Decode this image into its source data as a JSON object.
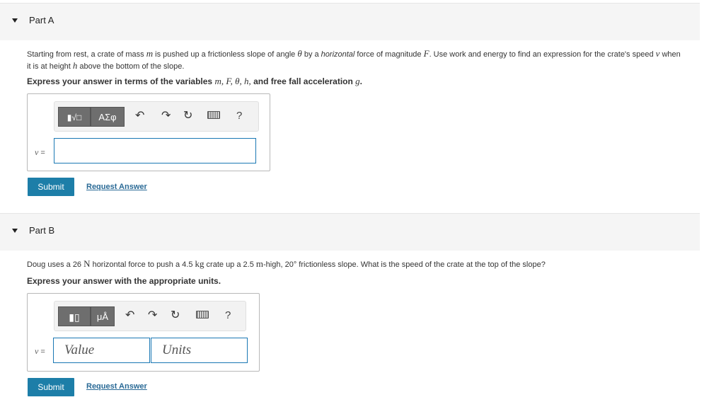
{
  "partA": {
    "title": "Part A",
    "problem": {
      "t1": "Starting from rest, a crate of mass ",
      "m": "m",
      "t2": " is pushed up a frictionless slope of angle ",
      "theta": "θ",
      "t3": " by a ",
      "horizontal": "horizontal",
      "t4": " force of magnitude ",
      "F": "F",
      "t5": ". Use work and energy to find an expression for the crate's speed ",
      "v": "v",
      "t6": " when it is at height ",
      "h": "h",
      "t7": " above the bottom of the slope."
    },
    "instruction": {
      "t1": "Express your answer in terms of the variables ",
      "vars": "m, F, θ, h,",
      "t2": " and free fall acceleration ",
      "g": "g",
      "t3": "."
    },
    "toolbar": {
      "template_label": "▮√□",
      "greek_label": "ΑΣφ",
      "help_label": "?"
    },
    "var_label": "v",
    "eq": " =",
    "submit_label": "Submit",
    "request_label": "Request Answer"
  },
  "partB": {
    "title": "Part B",
    "problem": {
      "t1": "Doug uses a 26 ",
      "N": "N",
      "t2": " horizontal force to push a 4.5 ",
      "kg": "kg",
      "t3": " crate up a 2.5 ",
      "mm": "m",
      "t4": "-high, 20° frictionless slope. What is the speed of the crate at the top of the slope?"
    },
    "instruction": "Express your answer with the appropriate units.",
    "toolbar": {
      "template_label": "▮▯",
      "units_label": "μÅ",
      "help_label": "?"
    },
    "var_label": "v",
    "eq": " =",
    "value_placeholder": "Value",
    "units_placeholder": "Units",
    "submit_label": "Submit",
    "request_label": "Request Answer"
  },
  "colors": {
    "submit_bg": "#1d7ea8",
    "link": "#2a6a96",
    "input_border": "#1a78b4",
    "header_bg": "#f5f5f5"
  },
  "icons": [
    "collapse-caret-icon",
    "undo-icon",
    "redo-icon",
    "reset-icon",
    "keyboard-icon",
    "help-icon"
  ]
}
